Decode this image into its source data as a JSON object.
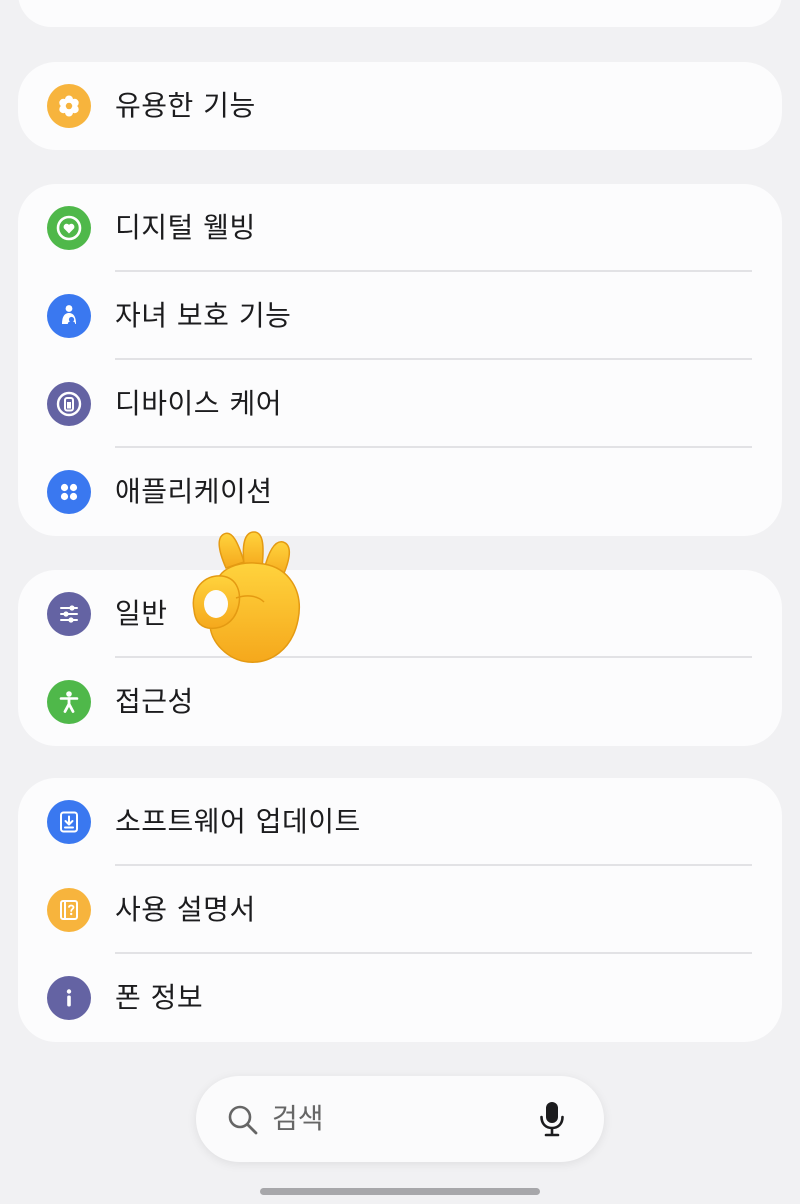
{
  "settings": {
    "group1": [
      {
        "label": "유용한 기능",
        "icon": "flower-icon",
        "color": "#f7b43d"
      }
    ],
    "group2": [
      {
        "label": "디지털 웰빙",
        "icon": "heart-ring-icon",
        "color": "#4fb84a"
      },
      {
        "label": "자녀 보호 기능",
        "icon": "parent-child-icon",
        "color": "#3a78f0"
      },
      {
        "label": "디바이스 케어",
        "icon": "battery-ring-icon",
        "color": "#6463a3"
      },
      {
        "label": "애플리케이션",
        "icon": "apps-grid-icon",
        "color": "#3a78f0"
      }
    ],
    "group3": [
      {
        "label": "일반",
        "icon": "sliders-icon",
        "color": "#6463a3"
      },
      {
        "label": "접근성",
        "icon": "accessibility-icon",
        "color": "#4fb84a"
      }
    ],
    "group4": [
      {
        "label": "소프트웨어 업데이트",
        "icon": "download-icon",
        "color": "#3a78f0"
      },
      {
        "label": "사용 설명서",
        "icon": "manual-icon",
        "color": "#f7b43d"
      },
      {
        "label": "폰 정보",
        "icon": "info-icon",
        "color": "#6463a3"
      }
    ]
  },
  "search": {
    "placeholder": "검색",
    "icon": "search-icon",
    "mic_icon": "microphone-icon"
  },
  "overlay": {
    "emoji_icon": "ok-hand-emoji-icon"
  }
}
